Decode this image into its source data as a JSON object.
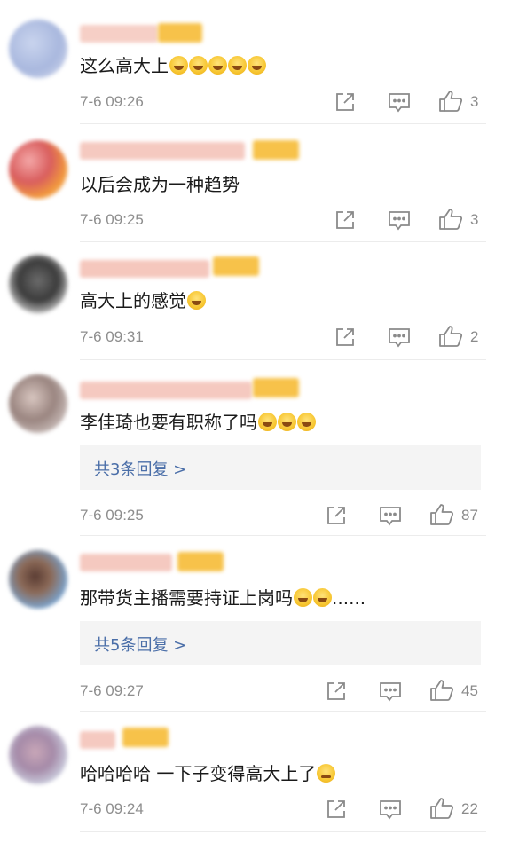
{
  "colors": {
    "link": "#4a6ea8",
    "meta": "#8e8e8e",
    "divider": "#ececec",
    "reply_bg": "#f4f4f4"
  },
  "icons": {
    "share": "share-icon",
    "comment": "comment-icon",
    "like": "thumbs-up-icon"
  },
  "comments": [
    {
      "text": "这么高大上",
      "emojis": [
        "laugh-cry",
        "laugh-cry",
        "laugh-cry",
        "laugh-cry",
        "laugh-cry"
      ],
      "time": "7-6 09:26",
      "likes": "3"
    },
    {
      "text": "以后会成为一种趋势",
      "emojis": [],
      "time": "7-6 09:25",
      "likes": "3"
    },
    {
      "text": "高大上的感觉",
      "emojis": [
        "laugh-cry"
      ],
      "time": "7-6 09:31",
      "likes": "2"
    },
    {
      "text": "李佳琦也要有职称了吗",
      "emojis": [
        "laugh",
        "laugh",
        "laugh"
      ],
      "time": "7-6 09:25",
      "likes": "87",
      "replies": "共3条回复 >"
    },
    {
      "text": "那带货主播需要持证上岗吗",
      "emojis": [
        "laugh",
        "laugh"
      ],
      "suffix": "......",
      "time": "7-6 09:27",
      "likes": "45",
      "replies": "共5条回复 >"
    },
    {
      "text": "哈哈哈哈 一下子变得高大上了",
      "emojis": [
        "smirk"
      ],
      "time": "7-6 09:24",
      "likes": "22"
    }
  ]
}
